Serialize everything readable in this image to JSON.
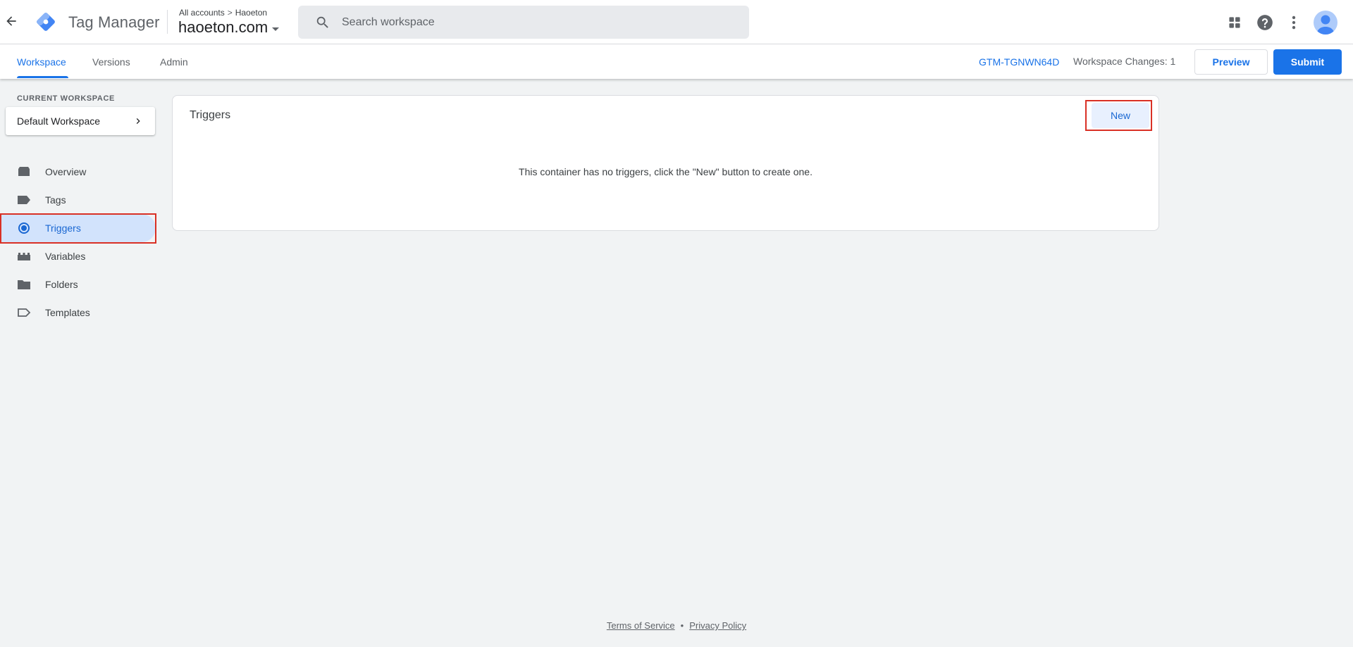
{
  "header": {
    "app_title": "Tag Manager",
    "breadcrumb": {
      "all_accounts": "All accounts",
      "separator": ">",
      "account": "Haoeton"
    },
    "container_name": "haoeton.com",
    "search": {
      "placeholder": "Search workspace",
      "value": ""
    },
    "icons": [
      "back-arrow-icon",
      "apps-grid-icon",
      "help-icon",
      "more-vert-icon",
      "account-avatar"
    ]
  },
  "subnav": {
    "tabs": [
      {
        "label": "Workspace",
        "active": true
      },
      {
        "label": "Versions",
        "active": false
      },
      {
        "label": "Admin",
        "active": false
      }
    ],
    "container_id": "GTM-TGNWN64D",
    "workspace_changes": "Workspace Changes: 1",
    "preview_label": "Preview",
    "submit_label": "Submit"
  },
  "sidebar": {
    "current_workspace_label": "CURRENT WORKSPACE",
    "workspace_name": "Default Workspace",
    "items": [
      {
        "label": "Overview",
        "icon": "overview-icon",
        "active": false
      },
      {
        "label": "Tags",
        "icon": "tag-icon",
        "active": false
      },
      {
        "label": "Triggers",
        "icon": "trigger-icon",
        "active": true
      },
      {
        "label": "Variables",
        "icon": "variables-icon",
        "active": false
      },
      {
        "label": "Folders",
        "icon": "folder-icon",
        "active": false
      },
      {
        "label": "Templates",
        "icon": "template-icon",
        "active": false
      }
    ]
  },
  "main": {
    "card_title": "Triggers",
    "new_button_label": "New",
    "empty_message": "This container has no triggers, click the \"New\" button to create one."
  },
  "footer": {
    "terms_label": "Terms of Service",
    "separator": "•",
    "privacy_label": "Privacy Policy"
  },
  "colors": {
    "accent": "#1a73e8",
    "active_nav_bg": "#d2e3fc",
    "highlight_box": "#d93025",
    "page_bg": "#f1f3f4"
  }
}
